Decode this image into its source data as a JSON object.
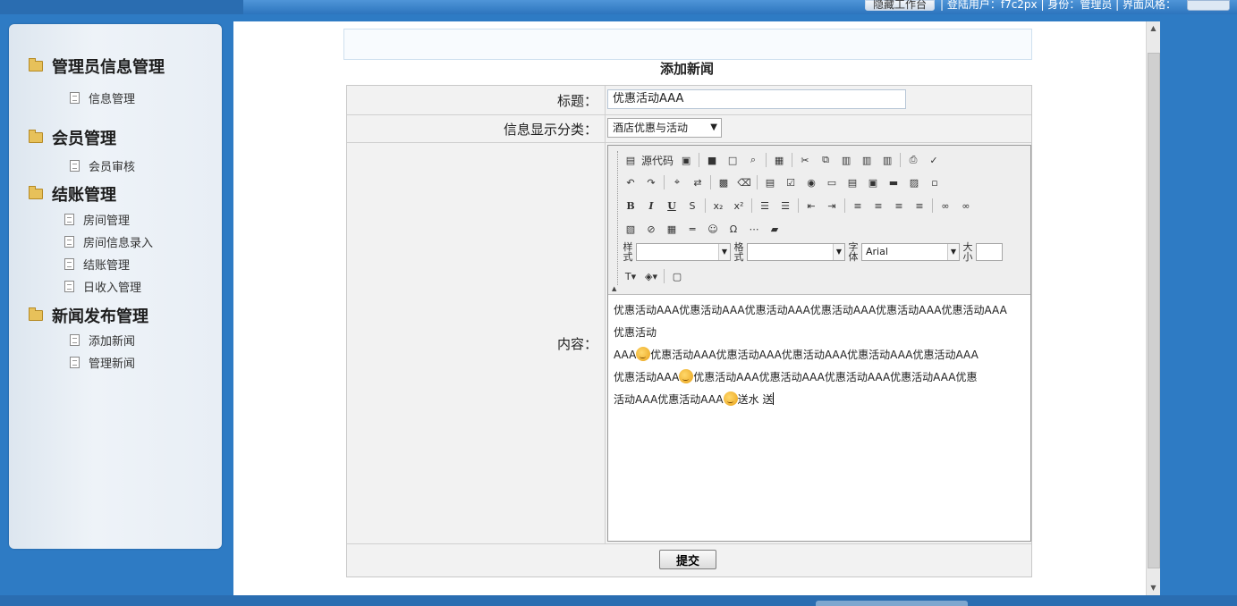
{
  "topbar": {
    "hide_button_label": "隐藏工作台",
    "user_info": "| 登陆用户：f7c2px | 身份：管理员 | 界面风格："
  },
  "sidebar": {
    "groups": [
      {
        "title": "管理员信息管理",
        "items": [
          "信息管理"
        ]
      },
      {
        "title": "会员管理",
        "items": [
          "会员审核"
        ]
      },
      {
        "title": "结账管理",
        "items": [
          "房间管理",
          "房间信息录入",
          "结账管理",
          "日收入管理"
        ]
      },
      {
        "title": "新闻发布管理",
        "items": [
          "添加新闻",
          "管理新闻"
        ]
      }
    ]
  },
  "page": {
    "title": "添加新闻"
  },
  "form": {
    "title_label": "标题：",
    "title_value": "优惠活动AAA",
    "category_label": "信息显示分类：",
    "category_value": "酒店优惠与活动",
    "content_label": "内容：",
    "submit_label": "提交"
  },
  "editor": {
    "source_label": "源代码",
    "style_label": "样式",
    "format_label": "格式",
    "font_label": "字体",
    "font_value": "Arial",
    "size_label": "大小",
    "content_lines": [
      "优惠活动AAA优惠活动AAA优惠活动AAA优惠活动AAA优惠活动AAA优惠活动AAA优惠活动",
      "AAA",
      "优惠活动AAA优惠活动AAA优惠活动AAA优惠活动AAA优惠活动AAA",
      "优惠活动AAA",
      "优惠活动AAA优惠活动AAA优惠活动AAA优惠活动AAA优惠",
      "活动AAA优惠活动AAA",
      "送水 送"
    ]
  },
  "icons": [
    "folder-icon",
    "document-icon",
    "bold-icon",
    "italic-icon",
    "underline-icon",
    "smiley-icon"
  ]
}
